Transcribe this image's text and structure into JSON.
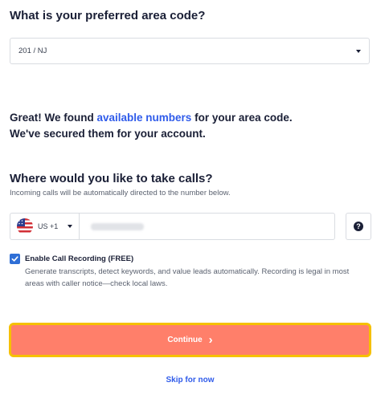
{
  "area_code": {
    "question": "What is your preferred area code?",
    "selected": "201 / NJ",
    "dropdown_icon": "caret-down-icon"
  },
  "found": {
    "line1_prefix": "Great! We found ",
    "line1_link": "available numbers",
    "line1_suffix": " for your area code.",
    "line2": "We've secured them for your account."
  },
  "calls": {
    "question": "Where would you like to take calls?",
    "subtitle": "Incoming calls will be automatically directed to the number below.",
    "country_code": "US +1",
    "flag_icon": "us-flag-icon",
    "help_icon": "question-circle-icon",
    "help_glyph": "?"
  },
  "recording": {
    "checked": true,
    "title": "Enable Call Recording (FREE)",
    "description": "Generate transcripts, detect keywords, and value leads automatically. Recording is legal in most areas with caller notice—check local laws."
  },
  "actions": {
    "continue_label": "Continue",
    "continue_arrow": "›",
    "skip_label": "Skip for now"
  },
  "colors": {
    "accent": "#2f5bea",
    "cta_background": "#ff7f6a",
    "cta_focus_ring": "#f5c000",
    "checkbox": "#2f6fd6"
  }
}
